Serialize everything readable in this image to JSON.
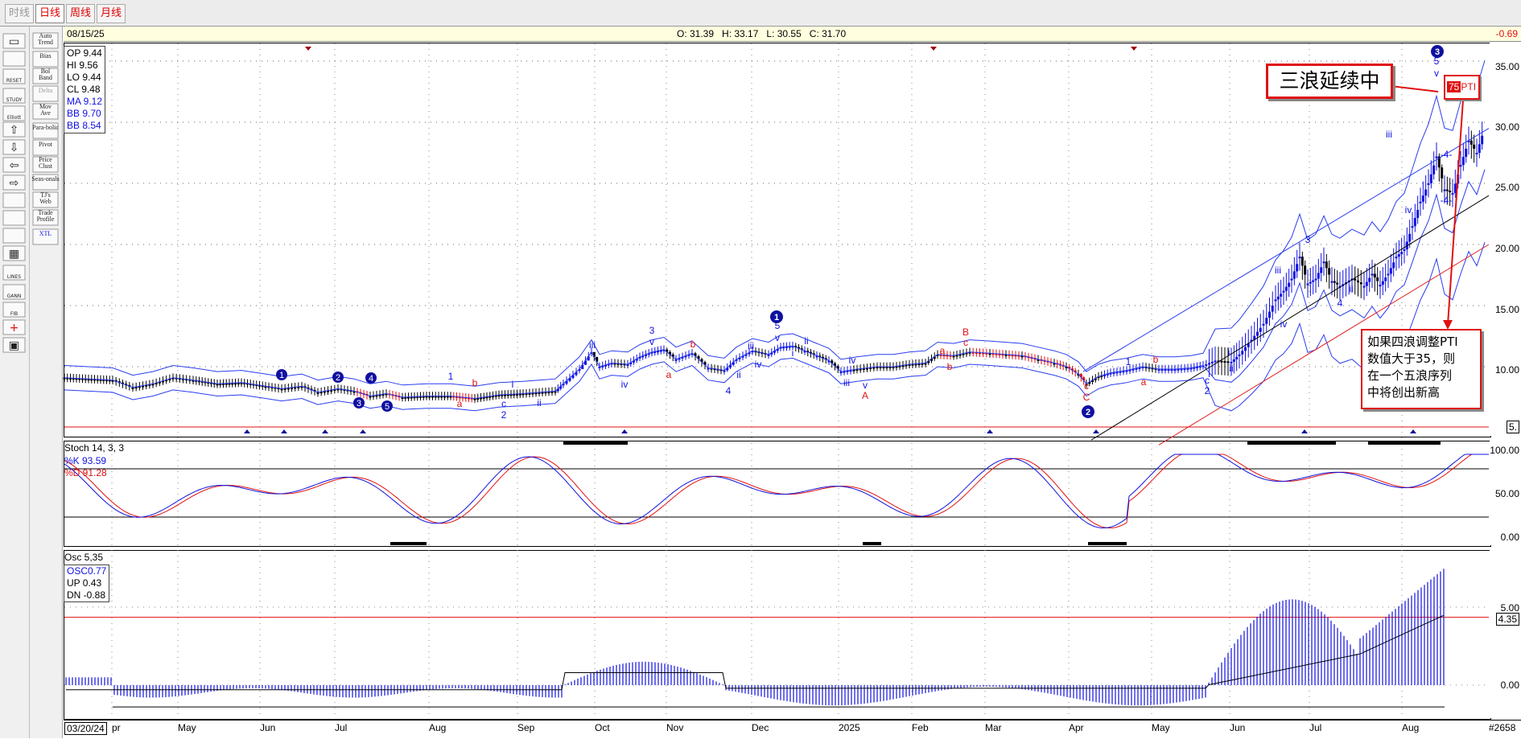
{
  "tabs": [
    {
      "label": "时线",
      "state": "disabled"
    },
    {
      "label": "日线",
      "state": "selected"
    },
    {
      "label": "周线",
      "state": "normal"
    },
    {
      "label": "月线",
      "state": "normal"
    }
  ],
  "toolbar_left": [
    "open-icon",
    "scale-icon",
    "reset-icon",
    "study-icon",
    "elliott-icon",
    "arrow-up-icon",
    "arrow-down-icon",
    "arrow-left-icon",
    "arrow-right-icon",
    "compress-icon",
    "expand-icon",
    "zoom-icon",
    "grid-icon",
    "lines-icon",
    "gann-icon",
    "fib-icon",
    "crosshair-icon",
    "print-icon"
  ],
  "toolbar_left_labels": {
    "reset": "RESET",
    "study": "STUDY",
    "elliott": "Elliott",
    "lines": "LINES",
    "gann": "GANN",
    "fib": "FIB"
  },
  "toolbar_right": [
    "Auto Trend",
    "Bias",
    "Bol Band",
    "Delta",
    "Mov Ave",
    "Para-bolic",
    "Pivot",
    "Price Clust",
    "Seas-onals",
    "TJ's Web",
    "Trade Profile",
    "XTL"
  ],
  "header": {
    "date": "08/15/25",
    "ohlc": "O: 31.39   H: 33.17   L: 30.55   C: 31.70",
    "change": "-0.69"
  },
  "info_box": {
    "op": "OP 9.44",
    "hi": "HI  9.56",
    "lo": "LO 9.44",
    "cl": "CL  9.48",
    "ma": "MA 9.12",
    "bb_upper": "BB  9.70",
    "bb_lower": "BB  8.54"
  },
  "annotations": {
    "callout_top": "三浪延续中",
    "pti_badge": "75",
    "pti_label": "PTI",
    "callout_bottom": [
      "如果四浪调整PTI",
      "数值大于35，则",
      "在一个五浪序列",
      "中将创出新高"
    ]
  },
  "price_axis": [
    "35.00",
    "30.00",
    "25.00",
    "20.00",
    "15.00",
    "10.00",
    "5."
  ],
  "stoch": {
    "title": "Stoch 14, 3, 3",
    "k": "%K  93.59",
    "d": "%D  91.28",
    "axis": [
      "100.00",
      "50.00",
      "0.00"
    ]
  },
  "osc": {
    "title": "Osc 5,35",
    "osc": "OSC0.77",
    "up": "UP   0.43",
    "dn": "DN  -0.88",
    "axis": [
      "5.00",
      "4.35",
      "0.00"
    ],
    "highlight": "4.35"
  },
  "x_axis": {
    "start": "03/20/24",
    "months": [
      "pr",
      "May",
      "Jun",
      "Jul",
      "Aug",
      "Sep",
      "Oct",
      "Nov",
      "Dec",
      "2025",
      "Feb",
      "Mar",
      "Apr",
      "May",
      "Jun",
      "Jul",
      "Aug"
    ],
    "bar_count": "#2658"
  },
  "wave_labels": [
    "1",
    "2",
    "3",
    "4",
    "5",
    "1",
    "a",
    "b",
    "c",
    "2",
    "i",
    "ii",
    "iii",
    "iv",
    "3",
    "a",
    "b",
    "4",
    "i",
    "ii",
    "iii",
    "iv",
    "v",
    "5",
    "1",
    "ii",
    "iii",
    "iv",
    "v",
    "A",
    "a",
    "b",
    "c",
    "B",
    "C",
    "2",
    "1",
    "a",
    "b",
    "c",
    "2",
    "i",
    "ii",
    "iii",
    "iv",
    "3",
    "4",
    "ii",
    "iii",
    "iv",
    "v",
    "5",
    "3",
    "-4-",
    "-4-"
  ],
  "colors": {
    "up": "#1010e0",
    "down": "#e01010",
    "neutral": "#000000",
    "callout_border": "#e01010",
    "channel_blue": "#2a3df0",
    "channel_black": "#000000",
    "channel_red": "#e02020",
    "accent_change": "#e01010"
  },
  "chart_data": {
    "type": "line",
    "title": "",
    "xlabel": "",
    "ylabel": "",
    "ylim": [
      0,
      37
    ],
    "x": [
      "Mar 24",
      "Apr 24",
      "May 24",
      "Jun 24",
      "Jul 24",
      "Aug 24",
      "Sep 24",
      "Oct 24",
      "Nov 24",
      "Dec 24",
      "Jan 25",
      "Feb 25",
      "Mar 25",
      "Apr 25",
      "May 25",
      "Jun 25",
      "Jul 25",
      "Aug 25"
    ],
    "series": [
      {
        "values": [
          9.1,
          9.0,
          8.6,
          8.3,
          7.6,
          7.5,
          8.0,
          10.5,
          11.0,
          11.5,
          9.8,
          10.6,
          11.3,
          9.2,
          9.8,
          14.0,
          19.0,
          31.7
        ]
      }
    ]
  }
}
